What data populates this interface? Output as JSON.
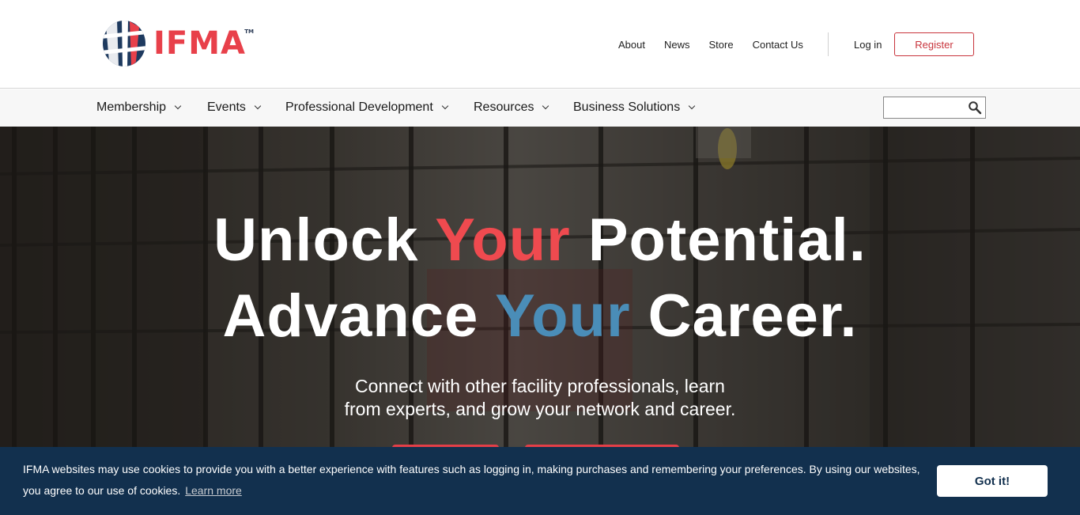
{
  "brand": {
    "name": "IFMA",
    "tm": "TM",
    "red": "#e8404a",
    "navy": "#1e3a5f"
  },
  "utility_nav": [
    "About",
    "News",
    "Store",
    "Contact Us"
  ],
  "auth": {
    "login": "Log in",
    "register": "Register"
  },
  "main_nav": [
    {
      "label": "Membership"
    },
    {
      "label": "Events"
    },
    {
      "label": "Professional Development"
    },
    {
      "label": "Resources"
    },
    {
      "label": "Business Solutions"
    }
  ],
  "search": {
    "placeholder": "",
    "icon": "search-icon"
  },
  "hero": {
    "line1": {
      "a": "Unlock ",
      "b": "Your",
      "c": " Potential."
    },
    "line2": {
      "a": "Advance ",
      "b": "Your",
      "c": " Career."
    },
    "subtitle_1": "Connect with other facility professionals, learn",
    "subtitle_2": "from experts, and grow your network and career.",
    "accent_red": "#ef4a4f",
    "accent_blue": "#4a8db8"
  },
  "cookie": {
    "text": "IFMA websites may use cookies to provide you with a better experience with features such as logging in, making purchases and remembering your preferences. By using our websites, you agree to our use of cookies.",
    "learn_more": "Learn more",
    "button": "Got it!",
    "bg": "#12304e"
  }
}
